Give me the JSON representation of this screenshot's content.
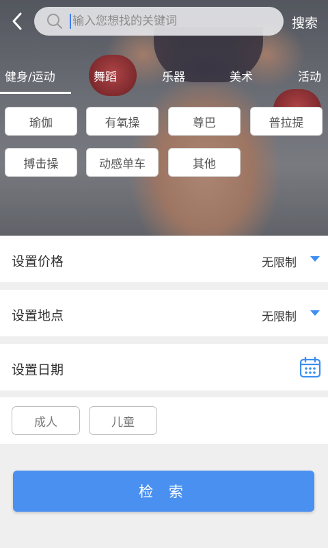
{
  "header": {
    "back_icon": "chevron-left-icon",
    "search_icon": "search-icon",
    "search_placeholder": "输入您想找的关键词",
    "search_value": "",
    "search_button": "搜索"
  },
  "tabs": [
    {
      "label": "健身/运动",
      "active": true
    },
    {
      "label": "舞蹈",
      "active": false
    },
    {
      "label": "乐器",
      "active": false
    },
    {
      "label": "美术",
      "active": false
    },
    {
      "label": "活动",
      "active": false
    }
  ],
  "chips": [
    "瑜伽",
    "有氧操",
    "尊巴",
    "普拉提",
    "搏击操",
    "动感单车",
    "其他"
  ],
  "filters": {
    "price": {
      "label": "设置价格",
      "value": "无限制",
      "icon": "triangle-down-icon"
    },
    "location": {
      "label": "设置地点",
      "value": "无限制",
      "icon": "triangle-down-icon"
    },
    "date": {
      "label": "设置日期",
      "icon": "calendar-icon"
    }
  },
  "age_groups": [
    "成人",
    "儿童"
  ],
  "submit_label": "检 索",
  "colors": {
    "accent": "#4a90f0",
    "dropdown_triangle": "#3c8ff0",
    "background": "#efefef"
  }
}
